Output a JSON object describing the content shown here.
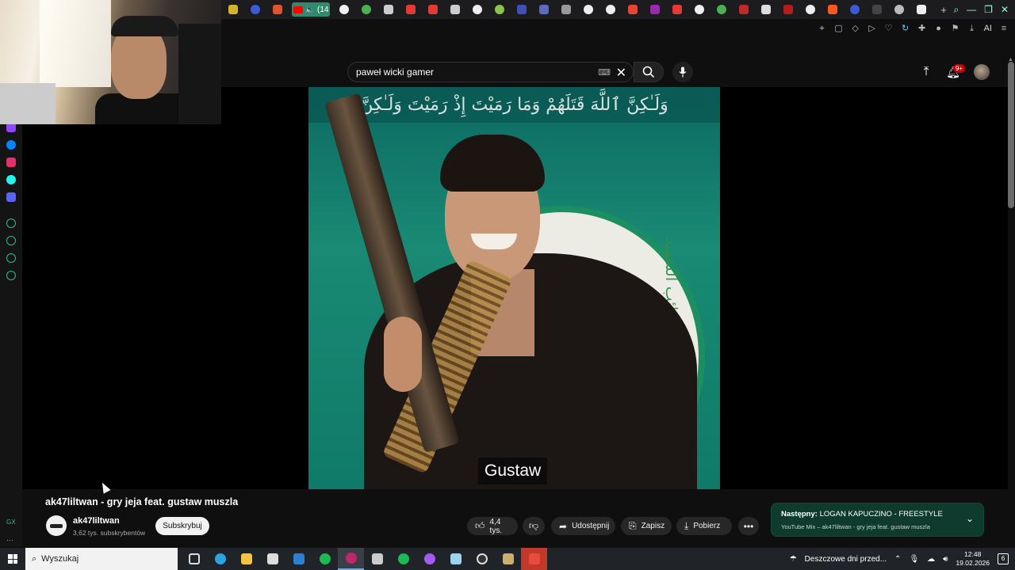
{
  "browser": {
    "active_tab_badge": "(14",
    "toolbar_ai_label": "AI"
  },
  "search": {
    "query": "paweł wicki gamer",
    "kbd_icon": "keyboard-icon"
  },
  "notifications": {
    "badge": "9+"
  },
  "video": {
    "banner_text": "وَلَـٰكِنَّ ٱللَّهَ قَتَلَهُمْ وَمَا رَمَيْتَ إِذْ رَمَيْتَ وَلَـٰكِنَّ",
    "emblem_text": "كتائب الشهيد",
    "caption": "Gustaw",
    "title": "ak47liltwan - gry jeja feat. gustaw muszla"
  },
  "channel": {
    "name": "ak47liltwan",
    "subscribers": "3,62 tys. subskrybentów",
    "subscribe_label": "Subskrybuj"
  },
  "actions": {
    "likes": "4,4 tys.",
    "share": "Udostępnij",
    "save": "Zapisz",
    "download": "Pobierz"
  },
  "up_next": {
    "prefix": "Następny: ",
    "title": "LOGAN KAPUCZINO - FREESTYLE",
    "subtitle": "YouTube Mix – ak47liltwan - gry jeja feat. gustaw muszla"
  },
  "taskbar": {
    "search_placeholder": "Wyszukaj",
    "weather": "Deszczowe dni przed...",
    "time": "12:48",
    "date": "19.02.2026",
    "notification_count": "6"
  },
  "colors": {
    "youtube_red": "#ff0000",
    "background": "#0f0f0f",
    "next_card": "#0f3a2e"
  }
}
